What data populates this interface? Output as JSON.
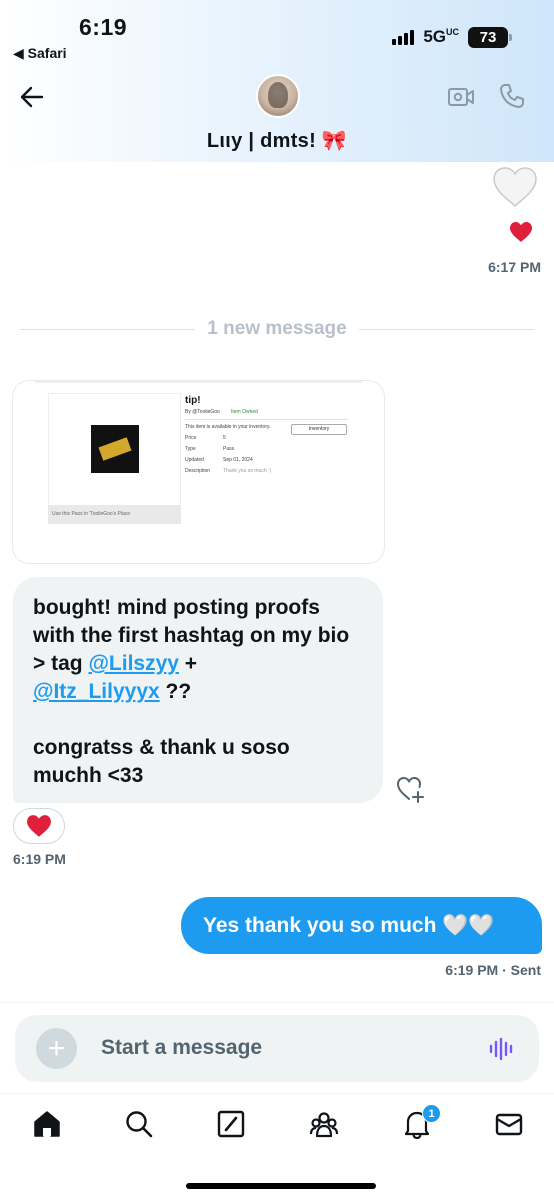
{
  "status_bar": {
    "time": "6:19",
    "back_app": "◀ Safari",
    "network": "5G",
    "network_suffix": "UC",
    "battery": "73"
  },
  "header": {
    "contact_name": "Lιιу | dmts! 🎀",
    "back_icon": "arrow-left-icon",
    "video_icon": "video-camera-icon",
    "phone_icon": "phone-icon"
  },
  "messages": {
    "first_time": "6:17 PM",
    "divider_text": "1 new message",
    "image_card": {
      "title": "tip!",
      "creator": "By @ToolieGoo",
      "owned": "Item Owned",
      "available": "This item is available in your inventory.",
      "inventory_button": "Inventory",
      "price_label": "Price",
      "price_value": "5",
      "type_label": "Type",
      "type_value": "Pass",
      "updated_label": "Updated",
      "updated_value": "Sep 01, 2024",
      "description_label": "Description",
      "description_value": "Thank you so much :)",
      "caption": "Use this Pass in 'ToolieGoo's Place"
    },
    "incoming": {
      "line1": "bought! mind posting proofs with the first hashtag on my bio > tag ",
      "mention1": "@Lilszyy",
      "plus": " +",
      "mention2": "@Itz_Lilyyyx",
      "tail": " ??",
      "line2": " congratss & thank u soso muchh <33"
    },
    "incoming_reaction": "❤️",
    "incoming_time": "6:19 PM",
    "outgoing": "Yes thank you so much 🤍🤍",
    "outgoing_time": "6:19 PM · Sent"
  },
  "composer": {
    "placeholder": "Start a message",
    "plus_label": "+"
  },
  "tabbar": {
    "notifications_badge": "1"
  },
  "colors": {
    "accent": "#1d9bf0",
    "bubble_in": "#eff3f4",
    "muted": "#536471"
  }
}
